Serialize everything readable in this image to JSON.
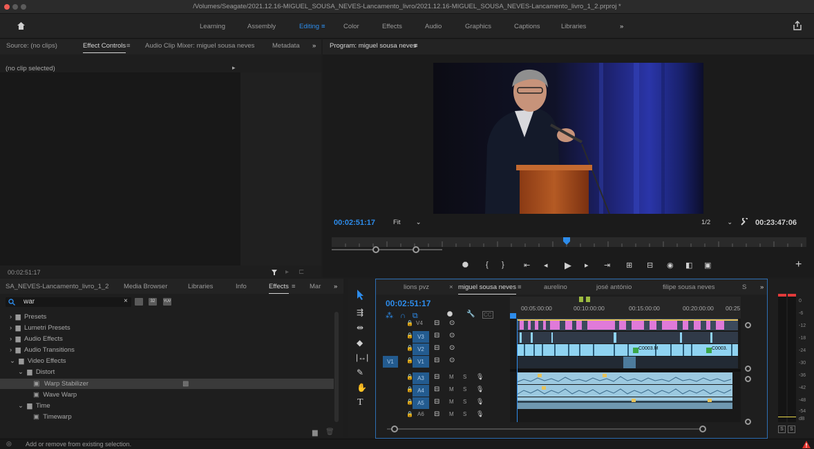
{
  "window": {
    "title": "/Volumes/Seagate/2021.12.16-MIGUEL_SOUSA_NEVES-Lancamento_livro/2021.12.16-MIGUEL_SOUSA_NEVES-Lancamento_livro_1_2.prproj *"
  },
  "menubar": {
    "home_icon": "home-icon",
    "workspaces": [
      "Learning",
      "Assembly",
      "Editing",
      "Color",
      "Effects",
      "Audio",
      "Graphics",
      "Captions",
      "Libraries"
    ],
    "active_workspace": "Editing",
    "editing_menu": "≡",
    "more": "»",
    "share_icon": "share-icon"
  },
  "source_panel": {
    "tabs": [
      "Source: (no clips)",
      "Effect Controls",
      "Audio Clip Mixer: miguel sousa neves",
      "Metadata"
    ],
    "active_tab": "Effect Controls",
    "tab_menu": "≡",
    "more": "»",
    "no_clip": "(no clip selected)",
    "play_arrow": "▸",
    "timecode": "00:02:51:17",
    "filter_icon": "filter-icon"
  },
  "program": {
    "title": "Program: miguel sousa neves",
    "menu": "≡",
    "timecode": "00:02:51:17",
    "fit": "Fit",
    "resolution": "1/2",
    "duration": "00:23:47:06",
    "playhead_fraction": 0.12
  },
  "transport": {
    "buttons": [
      "marker-icon",
      "mark-in-icon",
      "mark-out-icon",
      "go-to-in-icon",
      "step-back-icon",
      "play-icon",
      "step-forward-icon",
      "go-to-out-icon",
      "insert-icon",
      "overwrite-icon",
      "export-frame-icon",
      "comparison-icon",
      "multicam-icon"
    ],
    "add": "+"
  },
  "project_panel": {
    "tabs": [
      "SA_NEVES-Lancamento_livro_1_2",
      "Media Browser",
      "Libraries",
      "Info",
      "Effects",
      "Mar"
    ],
    "active_tab": "Effects",
    "tab_menu": "≡",
    "more": "»",
    "search_value": "war",
    "clear": "×",
    "badges": [
      "32",
      "YUV"
    ]
  },
  "effects_tree": [
    {
      "label": "Presets",
      "indent": 0,
      "type": "folder",
      "expanded": false
    },
    {
      "label": "Lumetri Presets",
      "indent": 0,
      "type": "folder",
      "expanded": false
    },
    {
      "label": "Audio Effects",
      "indent": 0,
      "type": "folder",
      "expanded": false
    },
    {
      "label": "Audio Transitions",
      "indent": 0,
      "type": "folder",
      "expanded": false
    },
    {
      "label": "Video Effects",
      "indent": 0,
      "type": "folder",
      "expanded": true
    },
    {
      "label": "Distort",
      "indent": 1,
      "type": "folder",
      "expanded": true
    },
    {
      "label": "Warp Stabilizer",
      "indent": 2,
      "type": "effect",
      "selected": true
    },
    {
      "label": "Wave Warp",
      "indent": 2,
      "type": "effect"
    },
    {
      "label": "Time",
      "indent": 1,
      "type": "folder",
      "expanded": true
    },
    {
      "label": "Timewarp",
      "indent": 2,
      "type": "effect"
    }
  ],
  "tools": [
    "selection-tool",
    "track-select-tool",
    "ripple-edit-tool",
    "razor-tool",
    "slip-tool",
    "pen-tool",
    "hand-tool",
    "type-tool"
  ],
  "timeline": {
    "tabs": [
      "lions pvz",
      "miguel sousa neves",
      "aurelino",
      "josé antónio",
      "filipe sousa neves",
      "S"
    ],
    "active_tab": "miguel sousa neves",
    "tab_close": "×",
    "tab_menu": "≡",
    "more": "»",
    "timecode": "00:02:51:17",
    "ruler": [
      "00:05:00:00",
      "00:10:00:00",
      "00:15:00:00",
      "00:20:00:00",
      "00:25:0"
    ],
    "video_tracks": [
      "V4",
      "V3",
      "V2",
      "V1"
    ],
    "source_patch": "V1",
    "audio_tracks": [
      "A3",
      "A4",
      "A5",
      "A6"
    ],
    "mute": "M",
    "solo": "S",
    "clips": [
      "C0003.M",
      "C0003."
    ]
  },
  "meter": {
    "labels": [
      "0",
      "-6",
      "-12",
      "-18",
      "-24",
      "-30",
      "-36",
      "-42",
      "-48",
      "-54",
      "dB"
    ],
    "solo": [
      "S",
      "S"
    ]
  },
  "status": {
    "text": "Add or remove from existing selection."
  },
  "colors": {
    "accent": "#2d8ceb",
    "clip_video": "#8fd3f1",
    "clip_pink": "#e07ad9",
    "clip_audio": "#9cc9e0",
    "clip_label_green": "#3aa648"
  }
}
